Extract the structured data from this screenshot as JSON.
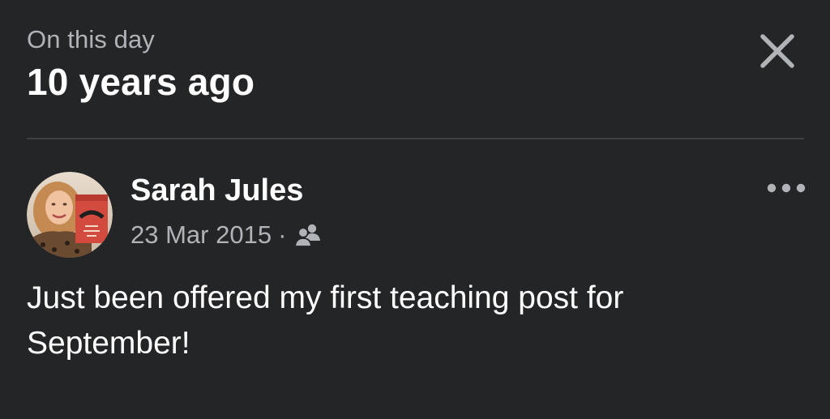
{
  "header": {
    "kicker": "On this day",
    "title": "10 years ago",
    "close_icon": "close-icon"
  },
  "post": {
    "author": "Sarah Jules",
    "date": "23 Mar 2015",
    "separator": "·",
    "audience_icon": "friends-icon",
    "more_icon": "more-options-icon",
    "text": "Just been offered my first teaching post for September!",
    "avatar": {
      "book_title_lines": [
        "SARAH JULES",
        "THE",
        "PROBLEM",
        "WITH",
        "IT"
      ]
    }
  },
  "colors": {
    "background": "#242526",
    "primary_text": "#ffffff",
    "secondary_text": "#b0b3b8",
    "divider": "#3e4042"
  }
}
